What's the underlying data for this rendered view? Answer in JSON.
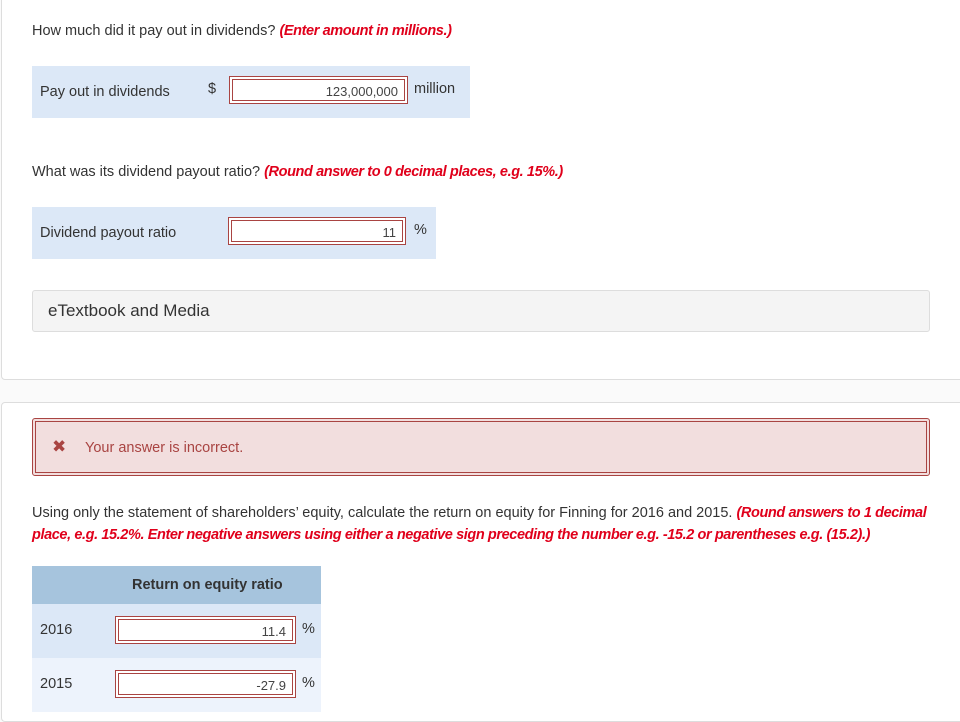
{
  "q1": {
    "question": "How much did it pay out in dividends?",
    "instruction": "(Enter amount in millions.)",
    "label": "Pay out in dividends",
    "currency": "$",
    "value": "123,000,000",
    "unit": "million"
  },
  "q2": {
    "question": "What was its dividend payout ratio?",
    "instruction": "(Round answer to 0 decimal places, e.g. 15%.)",
    "label": "Dividend payout ratio",
    "value": "11",
    "unit": "%"
  },
  "etextbook": {
    "label": "eTextbook and Media"
  },
  "feedback": {
    "icon": "x-icon",
    "message": "Your answer is incorrect.",
    "color": "#a94442"
  },
  "q3": {
    "question": "Using only the statement of shareholders’ equity, calculate the return on equity for Finning for 2016 and 2015.",
    "instruction": "(Round answers to 1 decimal place, e.g. 15.2%. Enter negative answers using either a negative sign preceding the number e.g. -15.2 or parentheses e.g. (15.2).)",
    "table": {
      "header": "Return on equity ratio",
      "rows": [
        {
          "year": "2016",
          "value": "11.4",
          "unit": "%"
        },
        {
          "year": "2015",
          "value": "-27.9",
          "unit": "%"
        }
      ]
    }
  },
  "colors": {
    "instruction": "#e0001b",
    "answer_row_bg": "#dce8f7",
    "table_header_bg": "#a6c4dd",
    "error_border": "#a94442",
    "error_bg": "#f2dede"
  }
}
